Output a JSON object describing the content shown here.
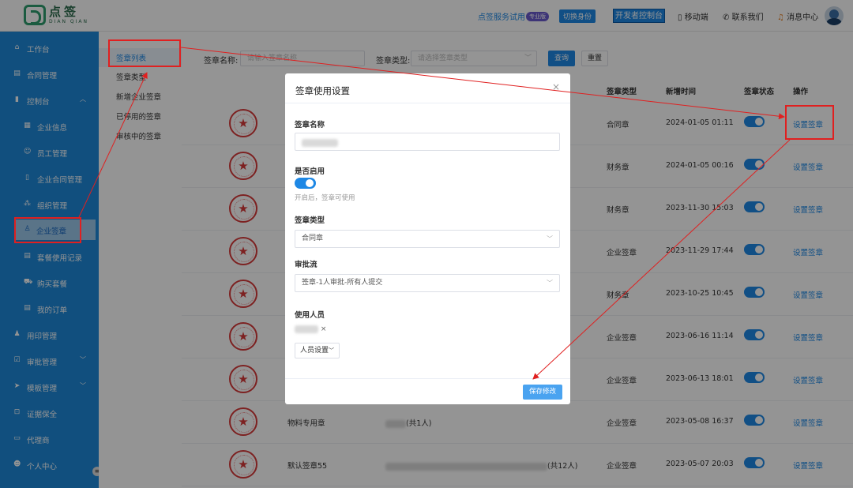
{
  "header": {
    "logo_cn": "点签",
    "logo_en": "DIAN QIAN",
    "trial": "点签服务试用",
    "pro_badge": "专业版",
    "switch": "切换身份",
    "dev_console": "开发者控制台",
    "mobile": "移动端",
    "contact": "联系我们",
    "messages": "消息中心"
  },
  "sidebar": {
    "items": [
      {
        "label": "工作台",
        "icon": "home-icon"
      },
      {
        "label": "合同管理",
        "icon": "document-icon"
      },
      {
        "label": "控制台",
        "icon": "bar-chart-icon"
      },
      {
        "label": "企业信息",
        "icon": "building-icon"
      },
      {
        "label": "员工管理",
        "icon": "user-icon"
      },
      {
        "label": "企业合同管理",
        "icon": "file-icon"
      },
      {
        "label": "组织管理",
        "icon": "org-icon"
      },
      {
        "label": "企业签章",
        "icon": "stamp-icon"
      },
      {
        "label": "套餐使用记录",
        "icon": "record-icon"
      },
      {
        "label": "购买套餐",
        "icon": "cart-icon"
      },
      {
        "label": "我的订单",
        "icon": "order-icon"
      },
      {
        "label": "用印管理",
        "icon": "seal-user-icon"
      },
      {
        "label": "审批管理",
        "icon": "check-icon"
      },
      {
        "label": "模板管理",
        "icon": "send-icon"
      },
      {
        "label": "证据保全",
        "icon": "lock-icon"
      },
      {
        "label": "代理商",
        "icon": "briefcase-icon"
      },
      {
        "label": "个人中心",
        "icon": "person-icon"
      }
    ]
  },
  "subnav": [
    "签章列表",
    "签章类型",
    "新增企业签章",
    "已停用的签章",
    "审核中的签章"
  ],
  "filters": {
    "name_label": "签章名称:",
    "name_placeholder": "请输入签章名称",
    "type_label": "签章类型:",
    "type_placeholder": "请选择签章类型",
    "search": "查询",
    "reset": "重置"
  },
  "table": {
    "headers": {
      "type": "签章类型",
      "time": "新增时间",
      "status": "签章状态",
      "action": "操作"
    },
    "rows": [
      {
        "name": "",
        "users": "",
        "type": "合同章",
        "time": "2024-01-05 01:11",
        "action": "设置签章"
      },
      {
        "name": "",
        "users": "",
        "type": "财务章",
        "time": "2024-01-05 00:16",
        "action": "设置签章"
      },
      {
        "name": "",
        "users": "",
        "type": "财务章",
        "time": "2023-11-30 15:03",
        "action": "设置签章"
      },
      {
        "name": "",
        "users": "",
        "type": "企业签章",
        "time": "2023-11-29 17:44",
        "action": "设置签章"
      },
      {
        "name": "",
        "users": "",
        "type": "财务章",
        "time": "2023-10-25 10:45",
        "action": "设置签章"
      },
      {
        "name": "",
        "users": "",
        "type": "企业签章",
        "time": "2023-06-16 11:14",
        "action": "设置签章"
      },
      {
        "name": "",
        "users": "",
        "type": "企业签章",
        "time": "2023-06-13 18:01",
        "action": "设置签章"
      },
      {
        "name": "物料专用章",
        "users": "(共1人)",
        "type": "企业签章",
        "time": "2023-05-08 16:37",
        "action": "设置签章"
      },
      {
        "name": "默认签章55",
        "users": "(共12人)",
        "type": "企业签章",
        "time": "2023-05-07 20:03",
        "action": "设置签章"
      }
    ]
  },
  "dialog": {
    "title": "签章使用设置",
    "close": "×",
    "name_label": "签章名称",
    "enabled_label": "是否启用",
    "enabled_hint": "开启后，签章可使用",
    "type_label": "签章类型",
    "type_value": "合同章",
    "flow_label": "审批流",
    "flow_value": "签章-1人审批-所有人提交",
    "users_label": "使用人员",
    "users_button": "人员设置",
    "save": "保存修改"
  },
  "colors": {
    "primary": "#1e88e5",
    "sidebar": "#1e88d9",
    "annotation": "#e02020"
  }
}
